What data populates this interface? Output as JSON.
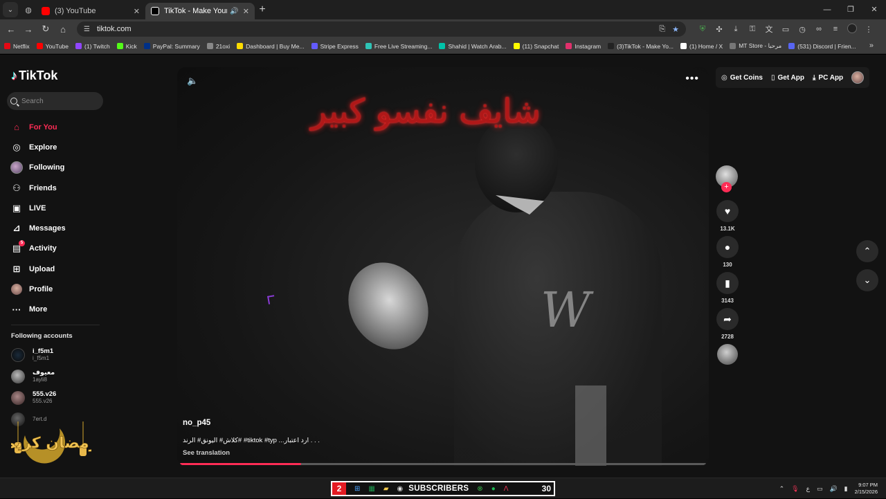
{
  "browser": {
    "tabs": [
      {
        "title": "(3) YouTube",
        "favicon_color": "#ff0000",
        "active": false
      },
      {
        "title": "TikTok - Make Your Day",
        "favicon_color": "#ffffff",
        "active": true
      }
    ],
    "url": "tiktok.com",
    "bookmarks": [
      {
        "label": "Netflix",
        "color": "#e50914"
      },
      {
        "label": "YouTube",
        "color": "#ff0000"
      },
      {
        "label": "(1) Twitch",
        "color": "#9146ff"
      },
      {
        "label": "Kick",
        "color": "#53fc18"
      },
      {
        "label": "PayPal: Summary",
        "color": "#003087"
      },
      {
        "label": "21oxi",
        "color": "#888888"
      },
      {
        "label": "Dashboard | Buy Me...",
        "color": "#ffdd00"
      },
      {
        "label": "Stripe Express",
        "color": "#635bff"
      },
      {
        "label": "Free Live Streaming...",
        "color": "#2ec4b6"
      },
      {
        "label": "Shahid | Watch Arab...",
        "color": "#00c2a8"
      },
      {
        "label": "(11) Snapchat",
        "color": "#fffc00"
      },
      {
        "label": "Instagram",
        "color": "#e1306c"
      },
      {
        "label": "(3)TikTok - Make Yo...",
        "color": "#222222"
      },
      {
        "label": "(1) Home / X",
        "color": "#ffffff"
      },
      {
        "label": "MT Store - مرحبا",
        "color": "#777777"
      },
      {
        "label": "(531) Discord | Frien...",
        "color": "#5865f2"
      }
    ]
  },
  "sidebar": {
    "logo": "TikTok",
    "search_placeholder": "Search",
    "nav": [
      {
        "label": "For You",
        "icon": "home-icon",
        "active": true
      },
      {
        "label": "Explore",
        "icon": "compass-icon"
      },
      {
        "label": "Following",
        "icon": "following-avatar-icon"
      },
      {
        "label": "Friends",
        "icon": "friends-icon"
      },
      {
        "label": "LIVE",
        "icon": "live-icon"
      },
      {
        "label": "Messages",
        "icon": "messages-icon"
      },
      {
        "label": "Activity",
        "icon": "activity-icon",
        "badge": "5"
      },
      {
        "label": "Upload",
        "icon": "upload-icon"
      },
      {
        "label": "Profile",
        "icon": "profile-avatar-icon"
      },
      {
        "label": "More",
        "icon": "more-icon"
      }
    ],
    "following_title": "Following accounts",
    "following": [
      {
        "name": "i_f5m1",
        "handle": "i_f5m1"
      },
      {
        "name": "معيوف",
        "handle": "1ayli8"
      },
      {
        "name": "555.v26",
        "handle": "555.v26"
      },
      {
        "name": "",
        "handle": "7ert.d"
      }
    ],
    "ramadan_label": "رمضان كريم"
  },
  "video": {
    "overlay_text": "شايف نفسو كبير",
    "author": "no_p45",
    "caption": "كلاش# اليونق# الرند# #tiktok #typ ...ارد اعتبار . . .",
    "see_translation": "See translation",
    "progress": 0.23
  },
  "actions": {
    "likes": "13.1K",
    "comments": "130",
    "saves": "3143",
    "shares": "2728"
  },
  "header": {
    "get_coins": "Get Coins",
    "get_app": "Get App",
    "pc_app": "PC App"
  },
  "taskbar": {
    "stream_count_left": "2",
    "subscribers_label": "SUBSCRIBERS",
    "subscribers_count": "30",
    "lang": "ع",
    "time": "9:07 PM",
    "date": "2/15/2026"
  }
}
